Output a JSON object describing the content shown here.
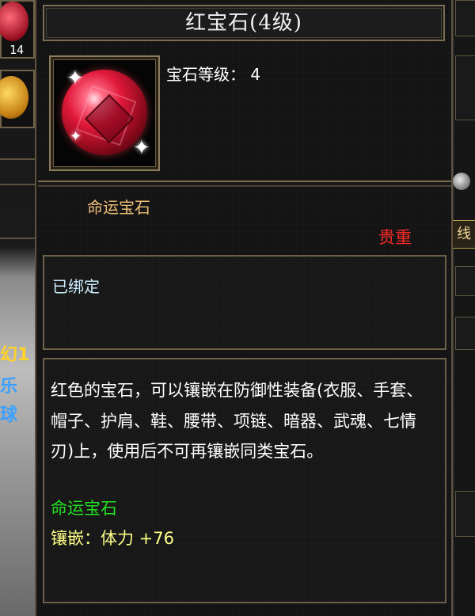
{
  "item": {
    "title": "红宝石(4级)",
    "level_label": "宝石等级：",
    "level_value": "4",
    "category": "命运宝石",
    "quality": "贵重",
    "bind_status": "已绑定",
    "description": "红色的宝石，可以镶嵌在防御性装备(衣服、手套、帽子、护肩、鞋、腰带、项链、暗器、武魂、七情刃)上，使用后不可再镶嵌同类宝石。",
    "type_tag": "命运宝石",
    "inlay": "镶嵌：体力 +76",
    "icon": "red-gem-icon"
  },
  "background": {
    "side_slot_count": "14",
    "right_label": "线",
    "left_text_1": "幻1",
    "left_text_2": "乐",
    "left_text_3": "球"
  },
  "colors": {
    "title": "#f0f0f0",
    "category": "#f0c078",
    "quality": "#ff2a2a",
    "bound": "#cfeeff",
    "type_tag": "#22e022",
    "inlay": "#ffff88",
    "border": "#7a6c50"
  }
}
